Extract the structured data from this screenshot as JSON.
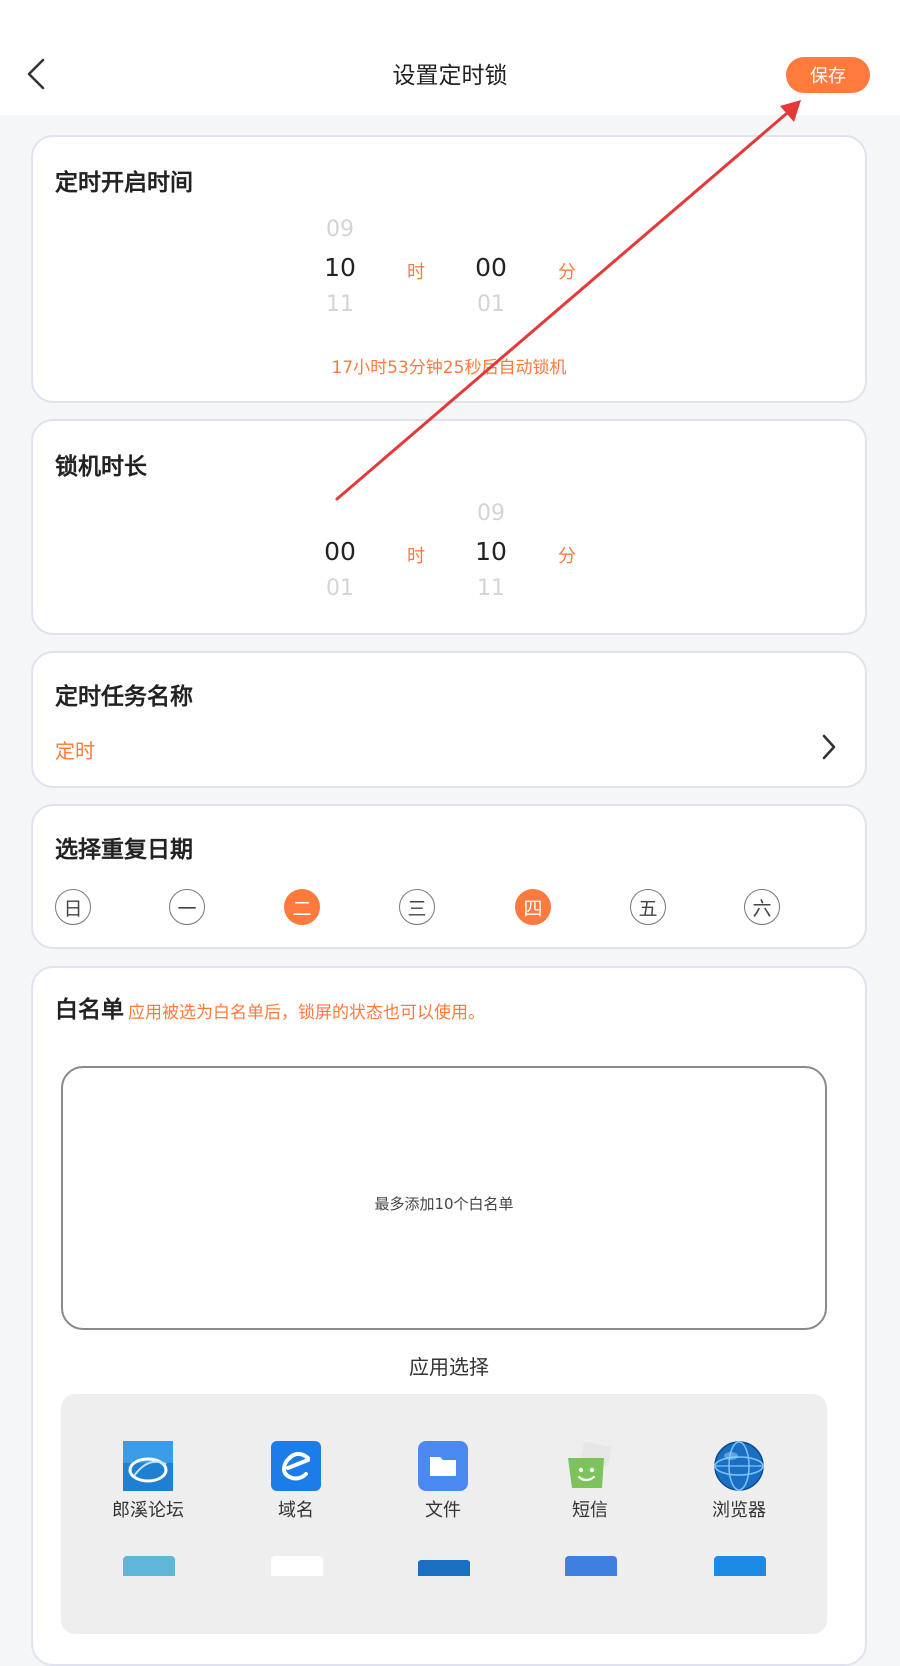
{
  "header": {
    "title": "设置定时锁",
    "save_label": "保存"
  },
  "start_time": {
    "title": "定时开启时间",
    "hour": {
      "prev": "09",
      "selected": "10",
      "next": "11",
      "unit": "时"
    },
    "minute": {
      "prev": "",
      "selected": "00",
      "next": "01",
      "unit": "分"
    },
    "countdown": "17小时53分钟25秒后自动锁机"
  },
  "lock_duration": {
    "title": "锁机时长",
    "hour": {
      "prev": "",
      "selected": "00",
      "next": "01",
      "unit": "时"
    },
    "minute": {
      "prev": "09",
      "selected": "10",
      "next": "11",
      "unit": "分"
    }
  },
  "task_name": {
    "title": "定时任务名称",
    "value": "定时"
  },
  "repeat": {
    "title": "选择重复日期",
    "days": [
      {
        "label": "日",
        "selected": false
      },
      {
        "label": "一",
        "selected": false
      },
      {
        "label": "二",
        "selected": true
      },
      {
        "label": "三",
        "selected": false
      },
      {
        "label": "四",
        "selected": true
      },
      {
        "label": "五",
        "selected": false
      },
      {
        "label": "六",
        "selected": false
      }
    ]
  },
  "whitelist": {
    "title": "白名单",
    "note": "应用被选为白名单后，锁屏的状态也可以使用。",
    "empty_hint": "最多添加10个白名单",
    "app_select_label": "应用选择",
    "apps": [
      {
        "label": "郎溪论坛",
        "icon": "forum-icon"
      },
      {
        "label": "域名",
        "icon": "domain-icon"
      },
      {
        "label": "文件",
        "icon": "folder-icon"
      },
      {
        "label": "短信",
        "icon": "message-icon"
      },
      {
        "label": "浏览器",
        "icon": "globe-icon"
      }
    ]
  },
  "colors": {
    "accent": "#ff7a3c",
    "card_border": "#dfe3f0",
    "annotation_arrow": "#e23a3a"
  }
}
